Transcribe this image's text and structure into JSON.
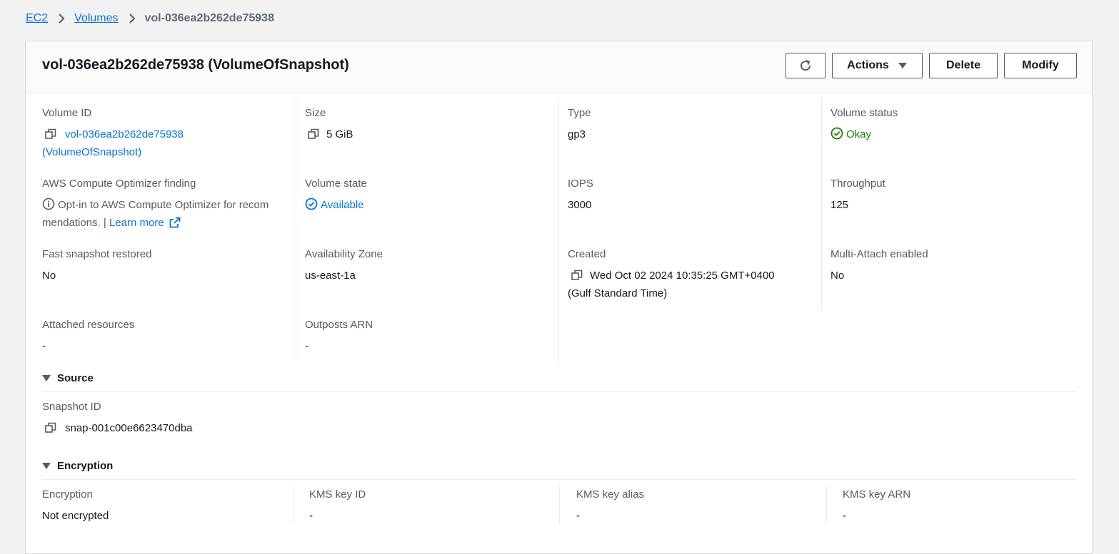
{
  "breadcrumb": {
    "items": [
      "EC2",
      "Volumes"
    ],
    "current": "vol-036ea2b262de75938"
  },
  "header": {
    "title": "vol-036ea2b262de75938 (VolumeOfSnapshot)",
    "actions_label": "Actions",
    "delete_label": "Delete",
    "modify_label": "Modify"
  },
  "details": {
    "volume_id_label": "Volume ID",
    "volume_id_line1": "vol-036ea2b262de75938",
    "volume_id_line2": "(VolumeOfSnapshot)",
    "size_label": "Size",
    "size_value": "5 GiB",
    "type_label": "Type",
    "type_value": "gp3",
    "status_label": "Volume status",
    "status_value": "Okay",
    "optimizer_label": "AWS Compute Optimizer finding",
    "optimizer_line1": "Opt-in to AWS Compute Optimizer for recom",
    "optimizer_line2": "mendations. |",
    "learn_more": "Learn more",
    "state_label": "Volume state",
    "state_value": "Available",
    "iops_label": "IOPS",
    "iops_value": "3000",
    "throughput_label": "Throughput",
    "throughput_value": "125",
    "fast_snapshot_label": "Fast snapshot restored",
    "fast_snapshot_value": "No",
    "az_label": "Availability Zone",
    "az_value": "us-east-1a",
    "created_label": "Created",
    "created_line1": "Wed Oct 02 2024 10:35:25 GMT+0400",
    "created_line2": "(Gulf Standard Time)",
    "multi_attach_label": "Multi-Attach enabled",
    "multi_attach_value": "No",
    "attached_label": "Attached resources",
    "attached_value": "-",
    "outposts_label": "Outposts ARN",
    "outposts_value": "-"
  },
  "source": {
    "title": "Source",
    "snapshot_label": "Snapshot ID",
    "snapshot_value": "snap-001c00e6623470dba"
  },
  "encryption": {
    "title": "Encryption",
    "encryption_label": "Encryption",
    "encryption_value": "Not encrypted",
    "kms_id_label": "KMS key ID",
    "kms_id_value": "-",
    "kms_alias_label": "KMS key alias",
    "kms_alias_value": "-",
    "kms_arn_label": "KMS key ARN",
    "kms_arn_value": "-"
  },
  "colors": {
    "link": "#0972d3",
    "success": "#1d8102",
    "text": "#16191f",
    "label": "#545b64",
    "background": "#f2f2f2"
  },
  "icons": [
    "chevron-right-icon",
    "refresh-icon",
    "caret-down-icon",
    "copy-icon",
    "check-circle-icon",
    "info-icon",
    "external-link-icon",
    "triangle-down-icon"
  ]
}
